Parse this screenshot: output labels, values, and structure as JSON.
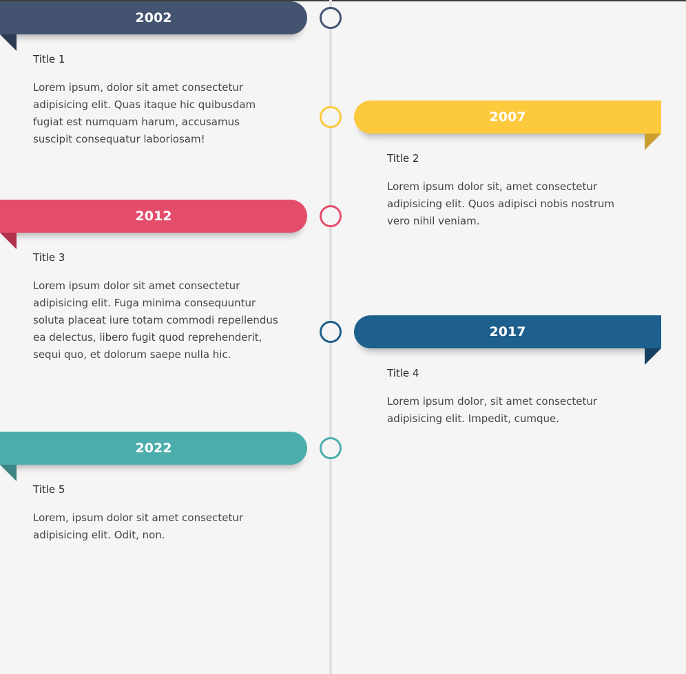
{
  "timeline": {
    "entries": [
      {
        "year": "2002",
        "title": "Title 1",
        "text": "Lorem ipsum, dolor sit amet consectetur adipisicing elit. Quas itaque hic quibusdam fugiat est numquam harum, accusamus suscipit consequatur laboriosam!",
        "side": "left",
        "color": "#445470",
        "fold_color": "#2f3b52"
      },
      {
        "year": "2007",
        "title": "Title 2",
        "text": "Lorem ipsum dolor sit, amet consectetur adipisicing elit. Quos adipisci nobis nostrum vero nihil veniam.",
        "side": "right",
        "color": "#fdc93d",
        "fold_color": "#c9a02f"
      },
      {
        "year": "2012",
        "title": "Title 3",
        "text": "Lorem ipsum dolor sit amet consectetur adipisicing elit. Fuga minima consequuntur soluta placeat iure totam commodi repellendus ea delectus, libero fugit quod reprehenderit, sequi quo, et dolorum saepe nulla hic.",
        "side": "left",
        "color": "#e44d6a",
        "fold_color": "#b0324b"
      },
      {
        "year": "2017",
        "title": "Title 4",
        "text": "Lorem ipsum dolor, sit amet consectetur adipisicing elit. Impedit, cumque.",
        "side": "right",
        "color": "#1d5f8d",
        "fold_color": "#163f60"
      },
      {
        "year": "2022",
        "title": "Title 5",
        "text": "Lorem, ipsum dolor sit amet consectetur adipisicing elit. Odit, non.",
        "side": "left",
        "color": "#4caeac",
        "fold_color": "#3a8684"
      }
    ]
  }
}
